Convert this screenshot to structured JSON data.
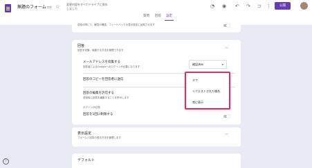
{
  "header": {
    "title": "無題のフォーム",
    "save_note": "変更内容をすべてドライブに保存しました",
    "tabs": [
      "質問",
      "回答",
      "設定"
    ],
    "active_tab": "設定",
    "send_label": "公開"
  },
  "settings": {
    "top_desc": "送信の際にて、解答の確認、フィードバックの表示設定に反映させます",
    "responses": {
      "title": "回答",
      "desc": "回答を収集、保護する方法を管理できます",
      "collect_email": {
        "label": "メールアドレスを収集する",
        "desc": "回答者によるGoogleへのログインが必要になります",
        "selected": "確認済み"
      },
      "send_copy": {
        "label": "回答のコピーを回答者に送信"
      },
      "allow_edit": {
        "label": "回答の編集を許可する",
        "desc": "送信後に回答を編集することを許可します"
      },
      "restrict_note": "ログインが必須",
      "limit_one": {
        "label": "回答を1回に制限する"
      }
    },
    "presentation": {
      "title": "表示設定",
      "desc": "フォームと回答の表示方法を管理します"
    },
    "defaults": {
      "title": "デフォルト"
    }
  },
  "dropdown": {
    "options": [
      "オフ",
      "リクエストされた場合",
      "常に表示"
    ]
  }
}
